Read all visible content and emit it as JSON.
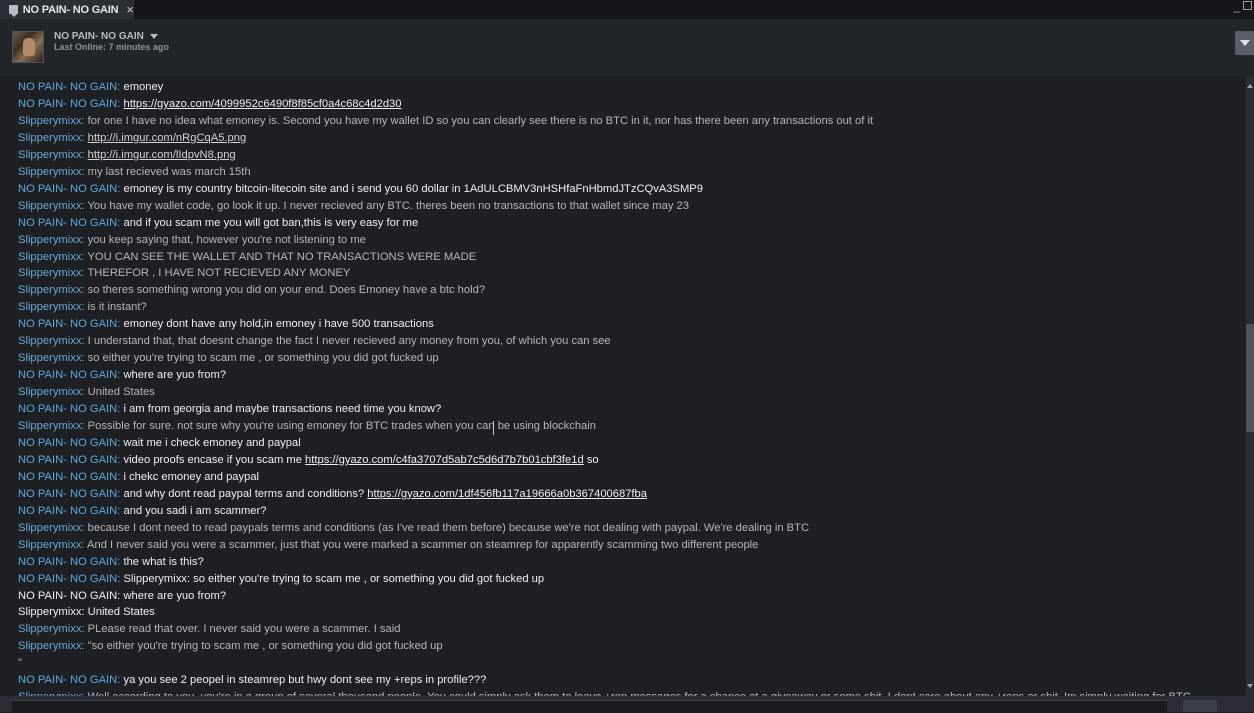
{
  "tab": {
    "title": "NO PAIN- NO GAIN",
    "close": "×",
    "icon": "chat-bubble-icon"
  },
  "window": {
    "minimize": "_"
  },
  "header": {
    "name": "NO PAIN- NO GAIN",
    "status": "Last Online: 7 minutes ago"
  },
  "colors": {
    "me": "#5ea8e0",
    "friend": "#6aa9d6",
    "background": "#1e2024"
  },
  "messages": [
    {
      "who": "NO PAIN- NO GAIN",
      "kind": "me",
      "parts": [
        {
          "t": "emoney"
        }
      ]
    },
    {
      "who": "NO PAIN- NO GAIN",
      "kind": "me",
      "parts": [
        {
          "t": "https://gyazo.com/4099952c6490f8f85cf0a4c68c4d2d30",
          "link": true
        }
      ]
    },
    {
      "who": "Slipperymixx",
      "kind": "frd",
      "parts": [
        {
          "t": "for one I have no idea what emoney is. Second you have my wallet ID so you can clearly see there is no BTC in it, nor has there been any transactions out of it"
        }
      ]
    },
    {
      "who": "Slipperymixx",
      "kind": "frd",
      "parts": [
        {
          "t": "http://i.imgur.com/nRgCqA5.png",
          "link": true
        }
      ]
    },
    {
      "who": "Slipperymixx",
      "kind": "frd",
      "parts": [
        {
          "t": "http://i.imgur.com/lIdpvN8.png",
          "link": true
        }
      ]
    },
    {
      "who": "Slipperymixx",
      "kind": "frd",
      "parts": [
        {
          "t": "my last recieved was march 15th"
        }
      ]
    },
    {
      "who": "NO PAIN- NO GAIN",
      "kind": "me",
      "parts": [
        {
          "t": "emoney is my country bitcoin-litecoin site and i send you 60 dollar in 1AdULCBMV3nHSHfaFnHbmdJTzCQvA3SMP9"
        }
      ]
    },
    {
      "who": "Slipperymixx",
      "kind": "frd",
      "parts": [
        {
          "t": "You have my wallet code, go look it up. I never recieved any BTC. theres been no transactions to that wallet since may 23"
        }
      ]
    },
    {
      "who": "NO PAIN- NO GAIN",
      "kind": "me",
      "parts": [
        {
          "t": "and if you scam me you will got ban,this is very easy for me"
        }
      ]
    },
    {
      "who": "Slipperymixx",
      "kind": "frd",
      "parts": [
        {
          "t": "you keep saying that, however you're not listening to me"
        }
      ]
    },
    {
      "who": "Slipperymixx",
      "kind": "frd",
      "parts": [
        {
          "t": "YOU CAN SEE THE WALLET AND THAT NO TRANSACTIONS WERE MADE"
        }
      ]
    },
    {
      "who": "Slipperymixx",
      "kind": "frd",
      "parts": [
        {
          "t": "THEREFOR , I HAVE NOT RECIEVED ANY MONEY"
        }
      ]
    },
    {
      "who": "Slipperymixx",
      "kind": "frd",
      "parts": [
        {
          "t": "so theres something wrong you did on your end. Does Emoney have a btc hold?"
        }
      ]
    },
    {
      "who": "Slipperymixx",
      "kind": "frd",
      "parts": [
        {
          "t": "is it instant?"
        }
      ]
    },
    {
      "who": "NO PAIN- NO GAIN",
      "kind": "me",
      "parts": [
        {
          "t": "emoney dont have any hold,in emoney i have 500 transactions"
        }
      ]
    },
    {
      "who": "Slipperymixx",
      "kind": "frd",
      "parts": [
        {
          "t": "I understand that, that doesnt change the fact I never recieved any money from you, of which you can see"
        }
      ]
    },
    {
      "who": "Slipperymixx",
      "kind": "frd",
      "parts": [
        {
          "t": "so either you're trying to scam me , or something you did got fucked up"
        }
      ]
    },
    {
      "who": "NO PAIN- NO GAIN",
      "kind": "me",
      "parts": [
        {
          "t": "where are yuo from?"
        }
      ]
    },
    {
      "who": "Slipperymixx",
      "kind": "frd",
      "parts": [
        {
          "t": "United States"
        }
      ]
    },
    {
      "who": "NO PAIN- NO GAIN",
      "kind": "me",
      "parts": [
        {
          "t": "i am from georgia and maybe transactions need time you know?"
        }
      ]
    },
    {
      "who": "Slipperymixx",
      "kind": "frd",
      "parts": [
        {
          "t": "Possible for sure. not sure why you're using emoney for BTC trades when you can be using blockchain"
        }
      ]
    },
    {
      "who": "NO PAIN- NO GAIN",
      "kind": "me",
      "parts": [
        {
          "t": "wait me i check emoney and paypal"
        }
      ]
    },
    {
      "who": "NO PAIN- NO GAIN",
      "kind": "me",
      "parts": [
        {
          "t": "video proofs encase if you scam me "
        },
        {
          "t": "https://gyazo.com/c4fa3707d5ab7c5d6d7b7b01cbf3fe1d",
          "link": true
        },
        {
          "t": " so"
        }
      ]
    },
    {
      "who": "NO PAIN- NO GAIN",
      "kind": "me",
      "parts": [
        {
          "t": "i chekc emoney and paypal"
        }
      ]
    },
    {
      "who": "NO PAIN- NO GAIN",
      "kind": "me",
      "parts": [
        {
          "t": "and why dont read paypal terms and conditions?  "
        },
        {
          "t": "https://gyazo.com/1df456fb117a19666a0b367400687fba",
          "link": true
        }
      ]
    },
    {
      "who": "NO PAIN- NO GAIN",
      "kind": "me",
      "parts": [
        {
          "t": "and you sadi i am scammer?"
        }
      ]
    },
    {
      "who": "Slipperymixx",
      "kind": "frd",
      "parts": [
        {
          "t": "because I dont need to read paypals terms and conditions (as I've read them before) because we're not dealing with paypal. We're dealing in BTC"
        }
      ]
    },
    {
      "who": "Slipperymixx",
      "kind": "frd",
      "parts": [
        {
          "t": "And I never said you were a scammer, just that you were marked a scammer on steamrep for apparently scamming two different people"
        }
      ]
    },
    {
      "who": "NO PAIN- NO GAIN",
      "kind": "me",
      "parts": [
        {
          "t": "the what is this?"
        }
      ]
    },
    {
      "who": "NO PAIN- NO GAIN",
      "kind": "me",
      "parts": [
        {
          "t": "Slipperymixx: so either you're trying to scam me , or something you did got fucked up"
        }
      ]
    },
    {
      "who": "NO PAIN- NO GAIN",
      "kind": "plain",
      "parts": [
        {
          "t": "where are yuo from?"
        }
      ]
    },
    {
      "who": "Slipperymixx",
      "kind": "plain",
      "parts": [
        {
          "t": "United States"
        }
      ]
    },
    {
      "who": "Slipperymixx",
      "kind": "frd",
      "parts": [
        {
          "t": "PLease read that over. I never said you were a scammer. I said"
        }
      ]
    },
    {
      "who": "Slipperymixx",
      "kind": "frd",
      "parts": [
        {
          "t": "\"so either you're trying to scam me , or something you did got fucked up"
        }
      ]
    },
    {
      "who": "",
      "kind": "frd",
      "parts": [
        {
          "t": "\""
        }
      ]
    },
    {
      "who": "NO PAIN- NO GAIN",
      "kind": "me",
      "parts": [
        {
          "t": "ya you see 2 peopel in steamrep but hwy dont see my +reps in profile???"
        }
      ]
    },
    {
      "who": "Slipperymixx",
      "kind": "frd",
      "parts": [
        {
          "t": "Well according to you, you're in a group of several thousand people. You could simply ask them to leave +rep messages for a chance at a giveaway or some shit. I dont care about any +reps or shit. Im simply waiting for BTC"
        }
      ]
    }
  ]
}
